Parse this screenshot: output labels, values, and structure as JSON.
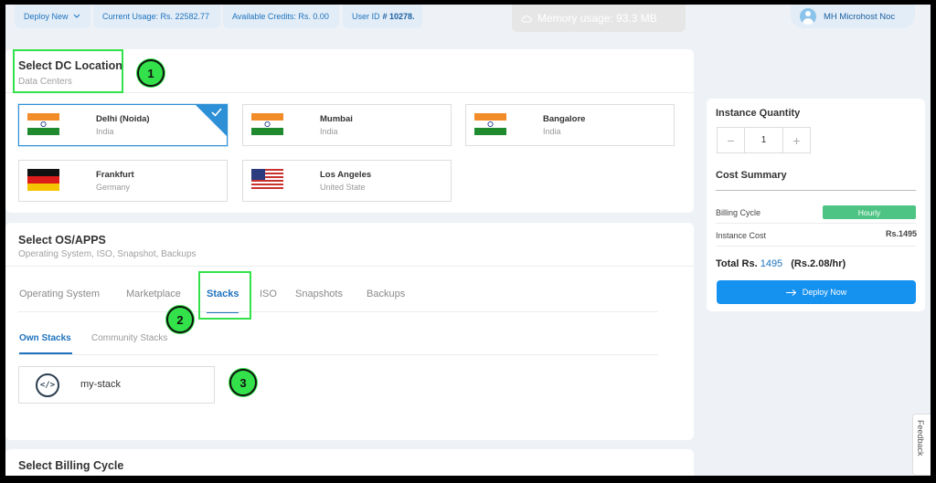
{
  "topbar": {
    "deploy_label": "Deploy New",
    "current_usage_label": "Current Usage: Rs. 22582.77",
    "credits_label": "Available Credits: Rs. 0.00",
    "user_id_label": "User ID",
    "user_id_value": "# 10278.",
    "memory_label": "Memory usage: 93.3 MB",
    "user_name": "MH Microhost Noc"
  },
  "dc": {
    "title": "Select DC Location",
    "subtitle": "Data Centers",
    "locations": [
      {
        "name": "Delhi (Noida)",
        "country": "India",
        "flag": "india-flag-icon",
        "selected": true
      },
      {
        "name": "Mumbai",
        "country": "India",
        "flag": "india-flag-icon",
        "selected": false
      },
      {
        "name": "Bangalore",
        "country": "India",
        "flag": "india-flag-icon",
        "selected": false
      },
      {
        "name": "Frankfurt",
        "country": "Germany",
        "flag": "germany-flag-icon",
        "selected": false
      },
      {
        "name": "Los Angeles",
        "country": "United State",
        "flag": "usa-flag-icon",
        "selected": false
      }
    ]
  },
  "os": {
    "title": "Select OS/APPS",
    "subtitle": "Operating System, ISO, Snapshot, Backups",
    "tabs": [
      "Operating System",
      "Marketplace",
      "Stacks",
      "ISO",
      "Snapshots",
      "Backups"
    ],
    "active_tab": "Stacks",
    "subtabs": [
      "Own Stacks",
      "Community Stacks"
    ],
    "active_subtab": "Own Stacks",
    "stacks": [
      {
        "name": "my-stack",
        "icon": "code-icon"
      }
    ]
  },
  "billing": {
    "title": "Select Billing Cycle"
  },
  "sidebar": {
    "quantity_title": "Instance Quantity",
    "quantity_value": "1",
    "cost_title": "Cost Summary",
    "billing_cycle_label": "Billing Cycle",
    "billing_cycle_value": "Hourly",
    "instance_cost_label": "Instance Cost",
    "instance_cost_value": "Rs.1495",
    "total_label": "Total Rs.",
    "total_value": "1495",
    "total_hourly": "(Rs.2.08/hr)",
    "deploy_button": "Deploy Now"
  },
  "annotations": [
    "1",
    "2",
    "3"
  ],
  "feedback_label": "Feedback",
  "colors": {
    "accent": "#1e73be",
    "button": "#1591f0",
    "hourly_badge": "#4dc483",
    "highlight": "#33e24a"
  }
}
